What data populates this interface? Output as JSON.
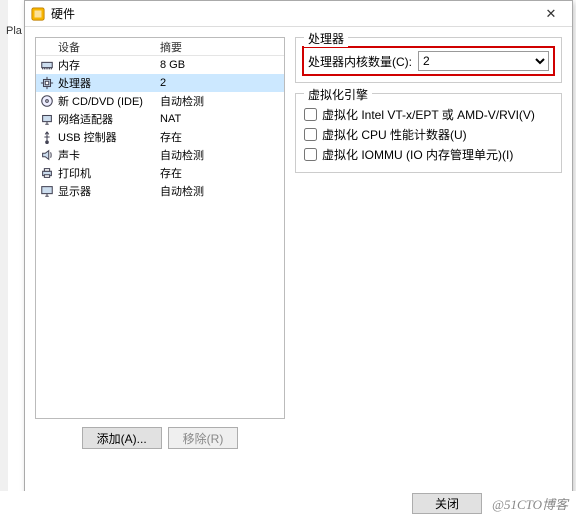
{
  "bgFragment": "Pla",
  "dialog": {
    "title": "硬件"
  },
  "table": {
    "headers": {
      "device": "设备",
      "summary": "摘要"
    },
    "rows": [
      {
        "icon": "memory-icon",
        "name": "内存",
        "summary": "8 GB",
        "selected": false
      },
      {
        "icon": "cpu-icon",
        "name": "处理器",
        "summary": "2",
        "selected": true
      },
      {
        "icon": "cd-icon",
        "name": "新 CD/DVD (IDE)",
        "summary": "自动检测",
        "selected": false
      },
      {
        "icon": "network-icon",
        "name": "网络适配器",
        "summary": "NAT",
        "selected": false
      },
      {
        "icon": "usb-icon",
        "name": "USB 控制器",
        "summary": "存在",
        "selected": false
      },
      {
        "icon": "sound-icon",
        "name": "声卡",
        "summary": "自动检测",
        "selected": false
      },
      {
        "icon": "printer-icon",
        "name": "打印机",
        "summary": "存在",
        "selected": false
      },
      {
        "icon": "display-icon",
        "name": "显示器",
        "summary": "自动检测",
        "selected": false
      }
    ]
  },
  "buttons": {
    "add": "添加(A)...",
    "remove": "移除(R)",
    "close": "关闭"
  },
  "processorGroup": {
    "legend": "处理器",
    "coreLabel": "处理器内核数量(C):",
    "coreValue": "2"
  },
  "virtGroup": {
    "legend": "虚拟化引擎",
    "opts": [
      "虚拟化 Intel VT-x/EPT 或 AMD-V/RVI(V)",
      "虚拟化 CPU 性能计数器(U)",
      "虚拟化 IOMMU (IO 内存管理单元)(I)"
    ]
  },
  "watermark": "@51CTO博客"
}
